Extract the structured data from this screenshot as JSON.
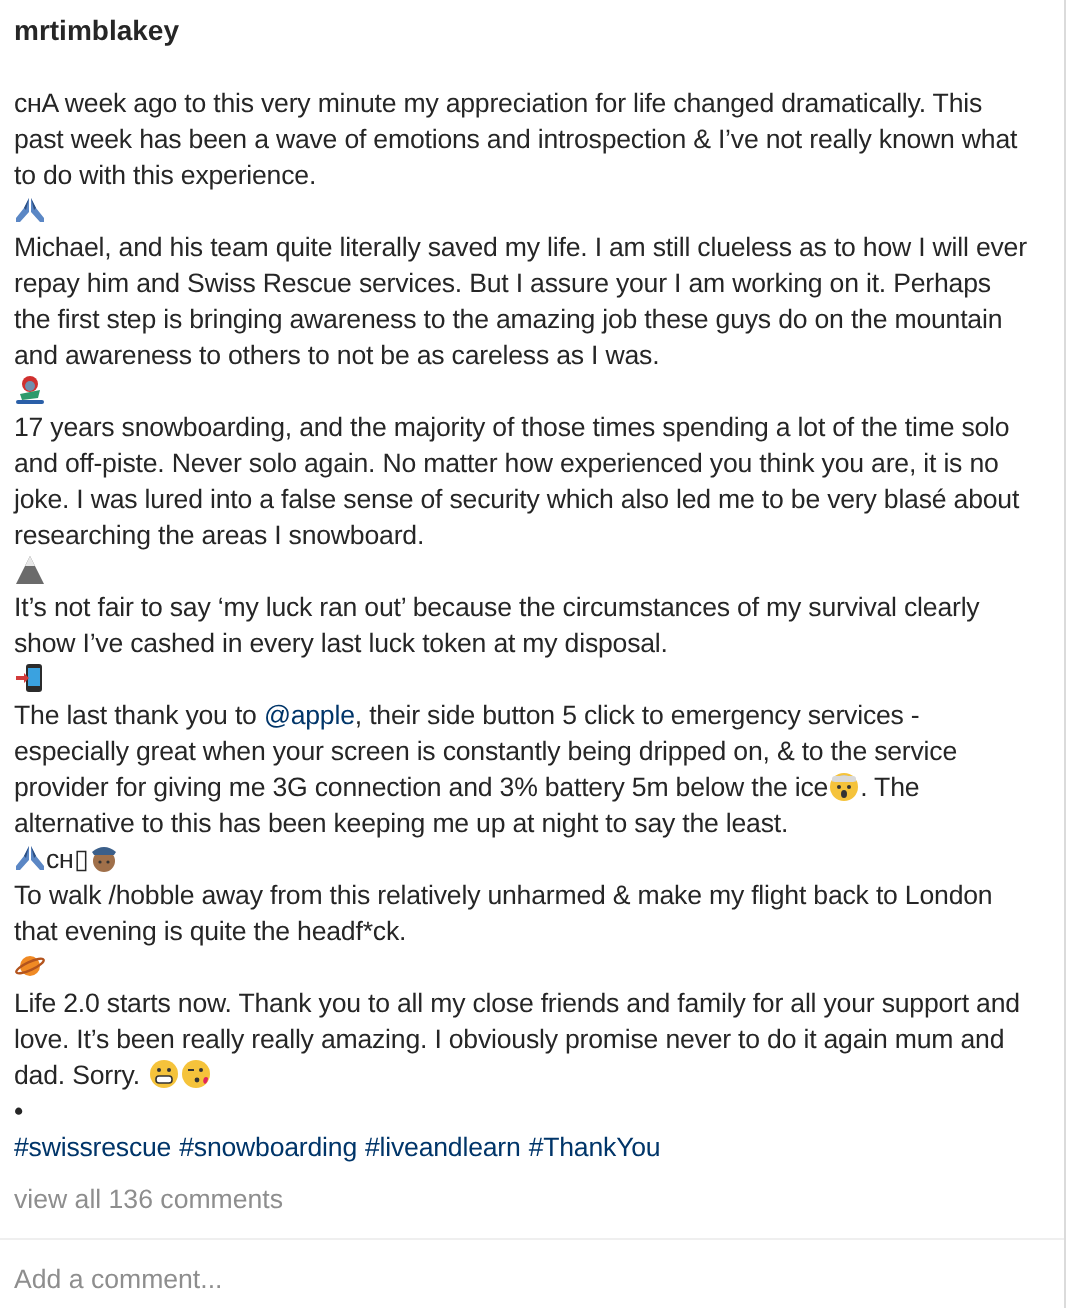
{
  "post": {
    "username": "mrtimblakey",
    "caption": [
      {
        "kind": "paragraph",
        "parts": [
          {
            "kind": "text",
            "text": "ᴄʜA week ago to this very minute my appreciation for life changed dramatically. This past week has been a wave of emotions and introspection & I’ve not really known what to do with this experience."
          }
        ]
      },
      {
        "kind": "paragraph",
        "parts": [
          {
            "kind": "hands"
          }
        ]
      },
      {
        "kind": "paragraph",
        "parts": [
          {
            "kind": "text",
            "text": "Michael, and his team quite literally saved my life. I am still clueless as to how I will ever repay him and Swiss Rescue services. But I assure your I am working on it. Perhaps the first step is bringing awareness to the amazing job these guys do on the mountain and awareness to others to not be as careless as I was."
          }
        ]
      },
      {
        "kind": "paragraph",
        "parts": [
          {
            "kind": "snowboarder"
          }
        ]
      },
      {
        "kind": "paragraph",
        "parts": [
          {
            "kind": "text",
            "text": "17 years snowboarding, and the majority of those times spending a lot of the time solo and off-piste. Never solo again. No matter how experienced you think you are, it is no joke. I was lured into a false sense of security which also led me to be very blasé about researching the areas I snowboard."
          }
        ]
      },
      {
        "kind": "paragraph",
        "parts": [
          {
            "kind": "mountain"
          }
        ]
      },
      {
        "kind": "paragraph",
        "parts": [
          {
            "kind": "text",
            "text": "It’s not fair to say ‘my luck ran out’ because the circumstances of my survival clearly show I’ve cashed in every last luck token at my disposal."
          }
        ]
      },
      {
        "kind": "paragraph",
        "parts": [
          {
            "kind": "phone"
          }
        ]
      },
      {
        "kind": "paragraph",
        "parts": [
          {
            "kind": "text",
            "text": "The last thank you to "
          },
          {
            "kind": "mention",
            "text": "@apple"
          },
          {
            "kind": "text",
            "text": ", their side button 5 click to emergency services - especially great when your screen is constantly being dripped on, & to the service provider for giving me 3G connection and 3% battery 5m below the ice"
          },
          {
            "kind": "astonished"
          },
          {
            "kind": "text",
            "text": ". The alternative to this has been keeping me up at night to say the least."
          }
        ]
      },
      {
        "kind": "paragraph",
        "parts": [
          {
            "kind": "hands"
          },
          {
            "kind": "text",
            "text": "ᴄʜ▯"
          },
          {
            "kind": "officer"
          }
        ]
      },
      {
        "kind": "paragraph",
        "parts": [
          {
            "kind": "text",
            "text": "To walk /hobble away from this relatively unharmed & make my flight back to London that evening is quite the headf*ck."
          }
        ]
      },
      {
        "kind": "paragraph",
        "parts": [
          {
            "kind": "planet"
          }
        ]
      },
      {
        "kind": "paragraph",
        "parts": [
          {
            "kind": "text",
            "text": "Life 2.0 starts now. Thank you to all my close friends and family for all your support and love. It’s been really really amazing. I obviously promise never to do it again mum and dad. Sorry. "
          },
          {
            "kind": "grimace"
          },
          {
            "kind": "kiss"
          }
        ]
      },
      {
        "kind": "paragraph",
        "parts": [
          {
            "kind": "text",
            "text": "•"
          }
        ]
      },
      {
        "kind": "paragraph",
        "parts": [
          {
            "kind": "hashtag",
            "text": "#swissrescue"
          },
          {
            "kind": "hashtag",
            "text": "#snowboarding"
          },
          {
            "kind": "hashtag",
            "text": "#liveandlearn"
          },
          {
            "kind": "hashtag",
            "text": "#ThankYou"
          }
        ]
      }
    ],
    "comments_link": "view all 136 comments",
    "comment_field": {
      "placeholder": "Add a comment..."
    }
  }
}
